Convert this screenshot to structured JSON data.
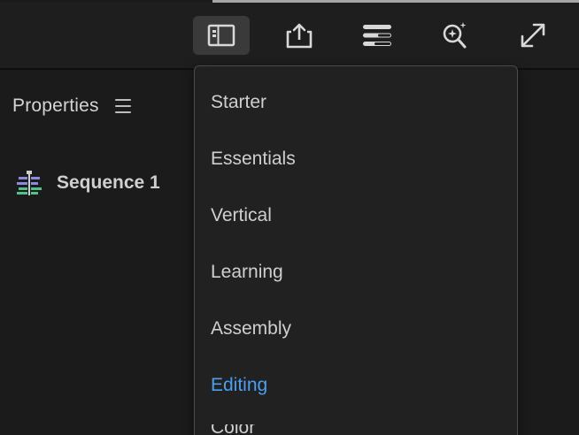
{
  "toolbar": {
    "buttons": [
      {
        "id": "workspaces",
        "icon": "workspaces-icon",
        "active": true
      },
      {
        "id": "export",
        "icon": "share-export-icon",
        "active": false
      },
      {
        "id": "panels",
        "icon": "panels-list-icon",
        "active": false
      },
      {
        "id": "quick-search",
        "icon": "sparkle-search-icon",
        "active": false
      },
      {
        "id": "fullscreen",
        "icon": "expand-icon",
        "active": false
      }
    ],
    "active_bg": "#3a3a3a"
  },
  "panel": {
    "title": "Properties",
    "sequence_label": "Sequence 1"
  },
  "workspace_menu": {
    "items": [
      {
        "label": "Starter",
        "selected": false
      },
      {
        "label": "Essentials",
        "selected": false
      },
      {
        "label": "Vertical",
        "selected": false
      },
      {
        "label": "Learning",
        "selected": false
      },
      {
        "label": "Assembly",
        "selected": false
      },
      {
        "label": "Editing",
        "selected": true
      },
      {
        "label": "Color",
        "selected": false
      }
    ],
    "selected_color": "#4a9ff0"
  }
}
